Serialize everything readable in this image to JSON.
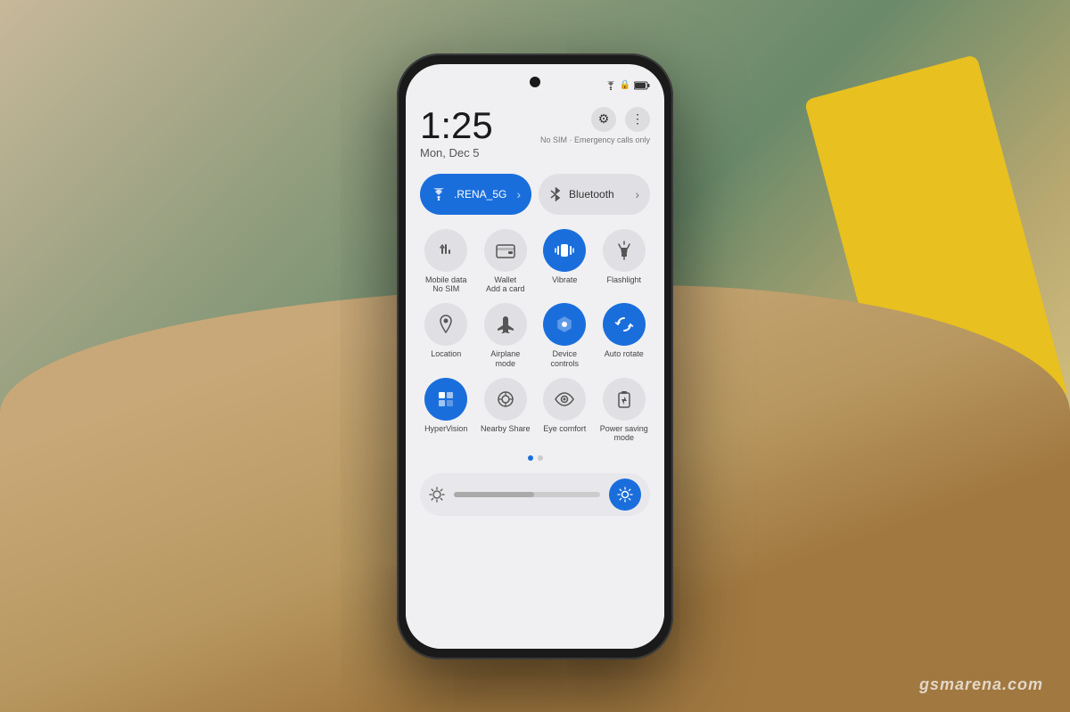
{
  "background": {
    "colors": {
      "main": "#6a8a70",
      "hand": "#c8a878",
      "yellow": "#e8c020",
      "blue": "#5080c0"
    }
  },
  "watermark": {
    "text": "gsmarena.com"
  },
  "phone": {
    "status_bar": {
      "icons": [
        "signal",
        "wifi",
        "lock",
        "battery"
      ]
    },
    "time": "1:25",
    "date": "Mon, Dec 5",
    "sim_text": "No SIM · Emergency calls only",
    "controls": {
      "settings_icon": "⚙",
      "more_icon": "⋮"
    },
    "toggles": [
      {
        "id": "wifi",
        "label": ".RENA_5G",
        "active": true,
        "icon": "wifi"
      },
      {
        "id": "bluetooth",
        "label": "Bluetooth",
        "active": false,
        "icon": "bluetooth"
      }
    ],
    "tiles": [
      {
        "id": "mobile-data",
        "label": "Mobile data\nNo SIM",
        "active": false,
        "icon": "arrows"
      },
      {
        "id": "wallet",
        "label": "Wallet\nAdd a card",
        "active": false,
        "icon": "card"
      },
      {
        "id": "vibrate",
        "label": "Vibrate",
        "active": true,
        "icon": "vibrate"
      },
      {
        "id": "flashlight",
        "label": "Flashlight",
        "active": false,
        "icon": "flashlight"
      },
      {
        "id": "location",
        "label": "Location",
        "active": false,
        "icon": "location"
      },
      {
        "id": "airplane",
        "label": "Airplane\nmode",
        "active": false,
        "icon": "airplane"
      },
      {
        "id": "device-controls",
        "label": "Device controls",
        "active": true,
        "icon": "home"
      },
      {
        "id": "auto-rotate",
        "label": "Auto rotate",
        "active": true,
        "icon": "rotate"
      },
      {
        "id": "hypervision",
        "label": "HyperVision",
        "active": true,
        "icon": "hypervision"
      },
      {
        "id": "nearby-share",
        "label": "Nearby Share",
        "active": false,
        "icon": "nearby"
      },
      {
        "id": "eye-comfort",
        "label": "Eye comfort",
        "active": false,
        "icon": "eye"
      },
      {
        "id": "power-saving",
        "label": "Power saving\nmode",
        "active": false,
        "icon": "battery-save"
      }
    ],
    "dots": [
      {
        "active": true
      },
      {
        "active": false
      }
    ],
    "brightness": {
      "value": 55,
      "sun_icon": "☀",
      "adjust_icon": "☀"
    }
  }
}
